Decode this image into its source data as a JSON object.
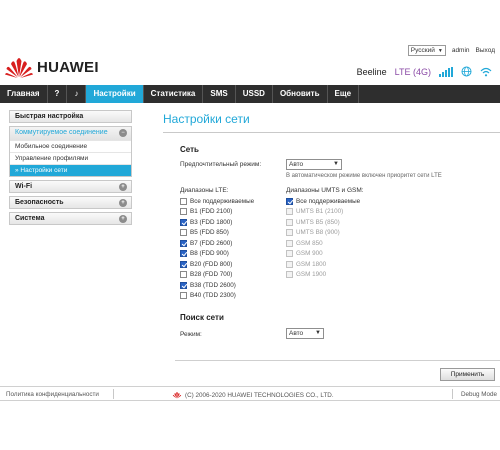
{
  "header": {
    "language": "Русский",
    "user": "admin",
    "logout": "Выход",
    "brand": "HUAWEI",
    "operator": "Beeline",
    "network": "LTE (4G)"
  },
  "nav": {
    "items": [
      "Главная",
      "?",
      "Настройки",
      "Статистика",
      "SMS",
      "USSD",
      "Обновить",
      "Еще"
    ],
    "active": "Настройки"
  },
  "sidebar": {
    "quick_setup": "Быстрая настройка",
    "group": {
      "label": "Коммутируемое соединение",
      "items": [
        "Мобильное соединение",
        "Управление профилями",
        "» Настройки сети"
      ],
      "active_index": 2
    },
    "wifi": "Wi-Fi",
    "security": "Безопасность",
    "system": "Система"
  },
  "main": {
    "title": "Настройки сети",
    "network_section": "Сеть",
    "preferred_mode_label": "Предпочтительный режим:",
    "preferred_mode_value": "Авто",
    "auto_hint": "В автоматическом режиме включен приоритет сети LTE",
    "lte_label": "Диапазоны LTE:",
    "lte_bands": [
      {
        "label": "Все поддерживаемые",
        "checked": false
      },
      {
        "label": "B1 (FDD 2100)",
        "checked": false
      },
      {
        "label": "B3 (FDD 1800)",
        "checked": true
      },
      {
        "label": "B5 (FDD 850)",
        "checked": false
      },
      {
        "label": "B7 (FDD 2600)",
        "checked": true
      },
      {
        "label": "B8 (FDD 900)",
        "checked": true
      },
      {
        "label": "B20 (FDD 800)",
        "checked": true
      },
      {
        "label": "B28 (FDD 700)",
        "checked": false
      },
      {
        "label": "B38 (TDD 2600)",
        "checked": true
      },
      {
        "label": "B40 (TDD 2300)",
        "checked": false
      }
    ],
    "umts_label": "Диапазоны UMTS и GSM:",
    "umts_bands": [
      {
        "label": "Все поддерживаемые",
        "checked": true,
        "disabled": false
      },
      {
        "label": "UMTS B1 (2100)",
        "checked": false,
        "disabled": true
      },
      {
        "label": "UMTS B5 (850)",
        "checked": false,
        "disabled": true
      },
      {
        "label": "UMTS B8 (900)",
        "checked": false,
        "disabled": true
      },
      {
        "label": "GSM 850",
        "checked": false,
        "disabled": true
      },
      {
        "label": "GSM 900",
        "checked": false,
        "disabled": true
      },
      {
        "label": "GSM 1800",
        "checked": false,
        "disabled": true
      },
      {
        "label": "GSM 1900",
        "checked": false,
        "disabled": true
      }
    ],
    "search_section": "Поиск сети",
    "search_mode_label": "Режим:",
    "search_mode_value": "Авто",
    "apply_button": "Применить"
  },
  "footer": {
    "privacy": "Политика конфиденциальности",
    "copyright": "(C) 2006-2020 HUAWEI TECHNOLOGIES CO., LTD.",
    "debug": "Debug Mode"
  },
  "colors": {
    "accent": "#21a8d8",
    "nav_bg": "#2e2e2e",
    "brand_red": "#d81e1e",
    "network_purple": "#8a4aa6"
  }
}
